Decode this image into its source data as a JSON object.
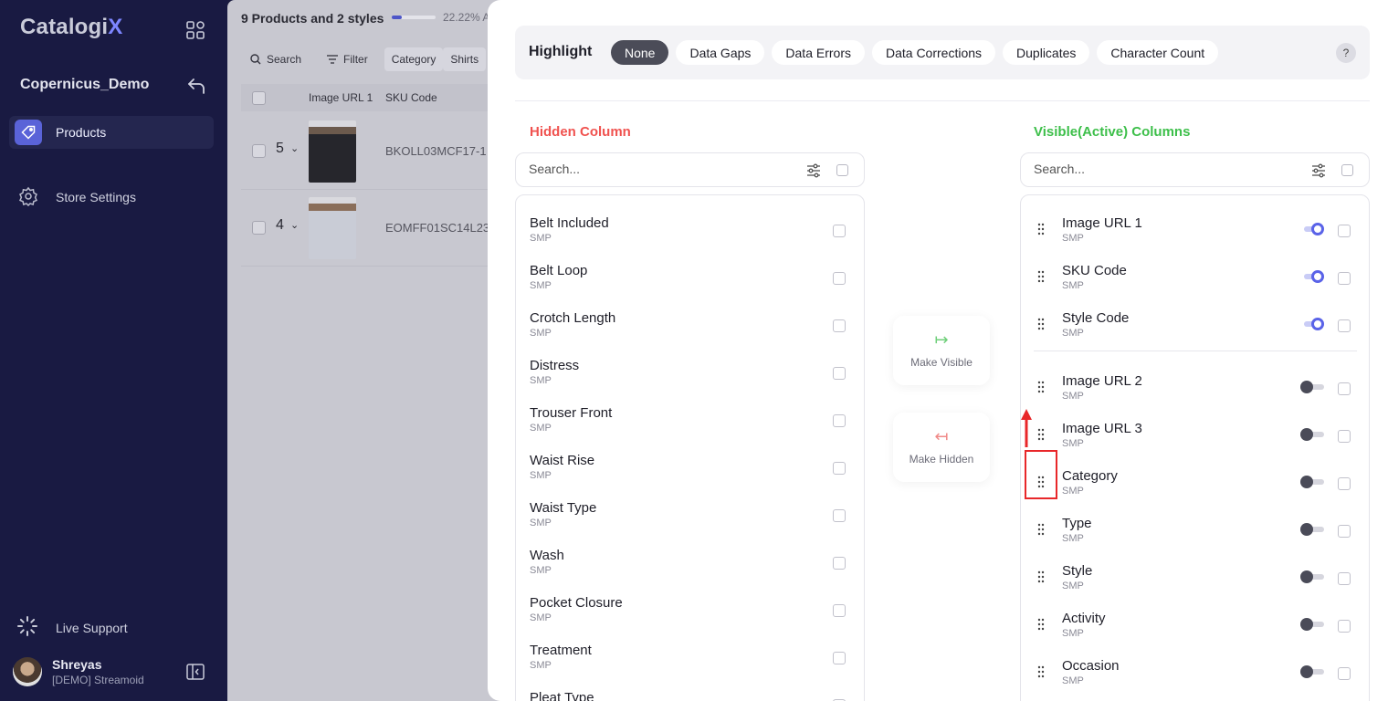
{
  "sidebar": {
    "logo_main": "Catalogi",
    "logo_accent": "X",
    "workspace": "Copernicus_Demo",
    "nav_products": "Products",
    "nav_store_settings": "Store Settings",
    "live_support": "Live Support",
    "user_name": "Shreyas",
    "user_org": "[DEMO] Streamoid"
  },
  "main": {
    "count_title": "9 Products and 2 styles",
    "progress_pct_text": "22.22% A",
    "progress_fraction": 0.2222,
    "toolbar": {
      "search": "Search",
      "filter": "Filter",
      "category_chip": "Category",
      "shirts_chip": "Shirts"
    },
    "columns": {
      "image_url": "Image URL 1",
      "sku_code": "SKU Code"
    },
    "rows": [
      {
        "num": "5",
        "sku": "BKOLL03MCF17-1"
      },
      {
        "num": "4",
        "sku": "EOMFF01SC14L23"
      }
    ]
  },
  "modal": {
    "highlight_label": "Highlight",
    "highlight_options": [
      "None",
      "Data Gaps",
      "Data Errors",
      "Data Corrections",
      "Duplicates",
      "Character Count"
    ],
    "help": "?",
    "hidden_title": "Hidden Column",
    "visible_title": "Visible(Active) Columns",
    "search_placeholder": "Search...",
    "make_visible": "Make Visible",
    "make_hidden": "Make Hidden",
    "hidden_columns": [
      {
        "name": "Belt Included",
        "sub": "SMP"
      },
      {
        "name": "Belt Loop",
        "sub": "SMP"
      },
      {
        "name": "Crotch Length",
        "sub": "SMP"
      },
      {
        "name": "Distress",
        "sub": "SMP"
      },
      {
        "name": "Trouser Front",
        "sub": "SMP"
      },
      {
        "name": "Waist Rise",
        "sub": "SMP"
      },
      {
        "name": "Waist Type",
        "sub": "SMP"
      },
      {
        "name": "Wash",
        "sub": "SMP"
      },
      {
        "name": "Pocket Closure",
        "sub": "SMP"
      },
      {
        "name": "Treatment",
        "sub": "SMP"
      },
      {
        "name": "Pleat Type",
        "sub": ""
      }
    ],
    "visible_columns": [
      {
        "name": "Image URL 1",
        "sub": "SMP",
        "on": true
      },
      {
        "name": "SKU Code",
        "sub": "SMP",
        "on": true
      },
      {
        "name": "Style Code",
        "sub": "SMP",
        "on": true
      },
      {
        "name": "Image URL 2",
        "sub": "SMP",
        "on": false
      },
      {
        "name": "Image URL 3",
        "sub": "SMP",
        "on": false
      },
      {
        "name": "Category",
        "sub": "SMP",
        "on": false
      },
      {
        "name": "Type",
        "sub": "SMP",
        "on": false
      },
      {
        "name": "Style",
        "sub": "SMP",
        "on": false
      },
      {
        "name": "Activity",
        "sub": "SMP",
        "on": false
      },
      {
        "name": "Occasion",
        "sub": "SMP",
        "on": false
      }
    ]
  },
  "colors": {
    "sidebar_bg": "#191a42",
    "accent": "#5a63e8",
    "hidden_title": "#f0524f",
    "visible_title": "#3dbf4a",
    "annotation": "#e8272a"
  }
}
